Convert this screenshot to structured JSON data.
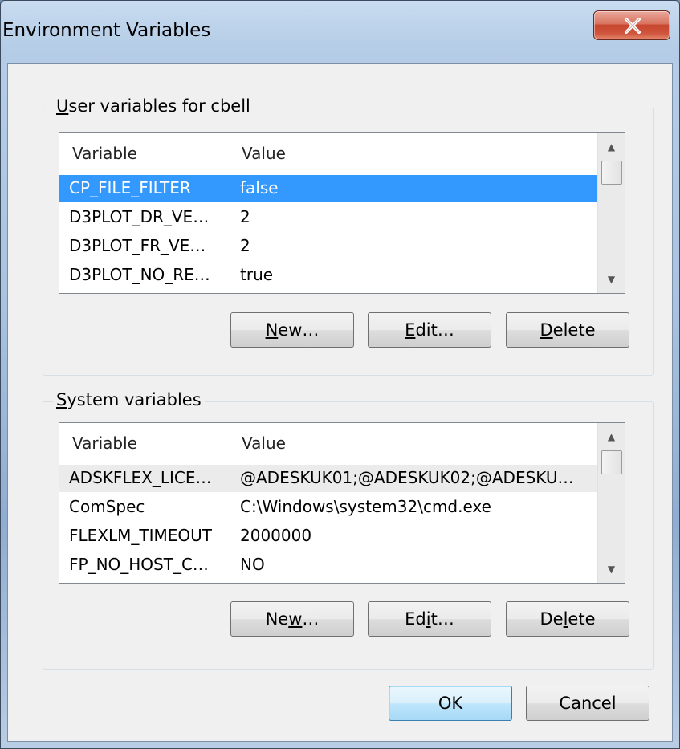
{
  "window": {
    "title": "Environment Variables"
  },
  "user_group": {
    "label": "User variables for cbell",
    "mnemonic": "U",
    "columns": [
      "Variable",
      "Value"
    ],
    "rows": [
      {
        "variable": "CP_FILE_FILTER",
        "value": "false",
        "selected": true
      },
      {
        "variable": "D3PLOT_DR_VE…",
        "value": "2"
      },
      {
        "variable": "D3PLOT_FR_VE…",
        "value": "2"
      },
      {
        "variable": "D3PLOT_NO_RE…",
        "value": "true"
      }
    ],
    "buttons": {
      "new_pre": "",
      "new_key": "N",
      "new_post": "ew…",
      "edit_pre": "",
      "edit_key": "E",
      "edit_post": "dit…",
      "delete_pre": "",
      "delete_key": "D",
      "delete_post": "elete"
    }
  },
  "system_group": {
    "label": "System variables",
    "mnemonic": "S",
    "columns": [
      "Variable",
      "Value"
    ],
    "rows": [
      {
        "variable": "ADSKFLEX_LICE…",
        "value": "@ADESKUK01;@ADESKUK02;@ADESKU…",
        "hover": true
      },
      {
        "variable": "ComSpec",
        "value": "C:\\Windows\\system32\\cmd.exe"
      },
      {
        "variable": "FLEXLM_TIMEOUT",
        "value": "2000000"
      },
      {
        "variable": "FP_NO_HOST_C…",
        "value": "NO"
      }
    ],
    "buttons": {
      "new_pre": "Ne",
      "new_key": "w",
      "new_post": "…",
      "edit_pre": "Ed",
      "edit_key": "i",
      "edit_post": "t…",
      "delete_pre": "De",
      "delete_key": "l",
      "delete_post": "ete"
    }
  },
  "dialog_buttons": {
    "ok": "OK",
    "cancel": "Cancel"
  },
  "icons": {
    "close": "close-icon",
    "scroll_up": "scroll-up-arrow-icon",
    "scroll_down": "scroll-down-arrow-icon"
  },
  "colors": {
    "selection": "#3399ff",
    "close_button": "#c7442c",
    "default_button_border": "#3c7fb1"
  }
}
